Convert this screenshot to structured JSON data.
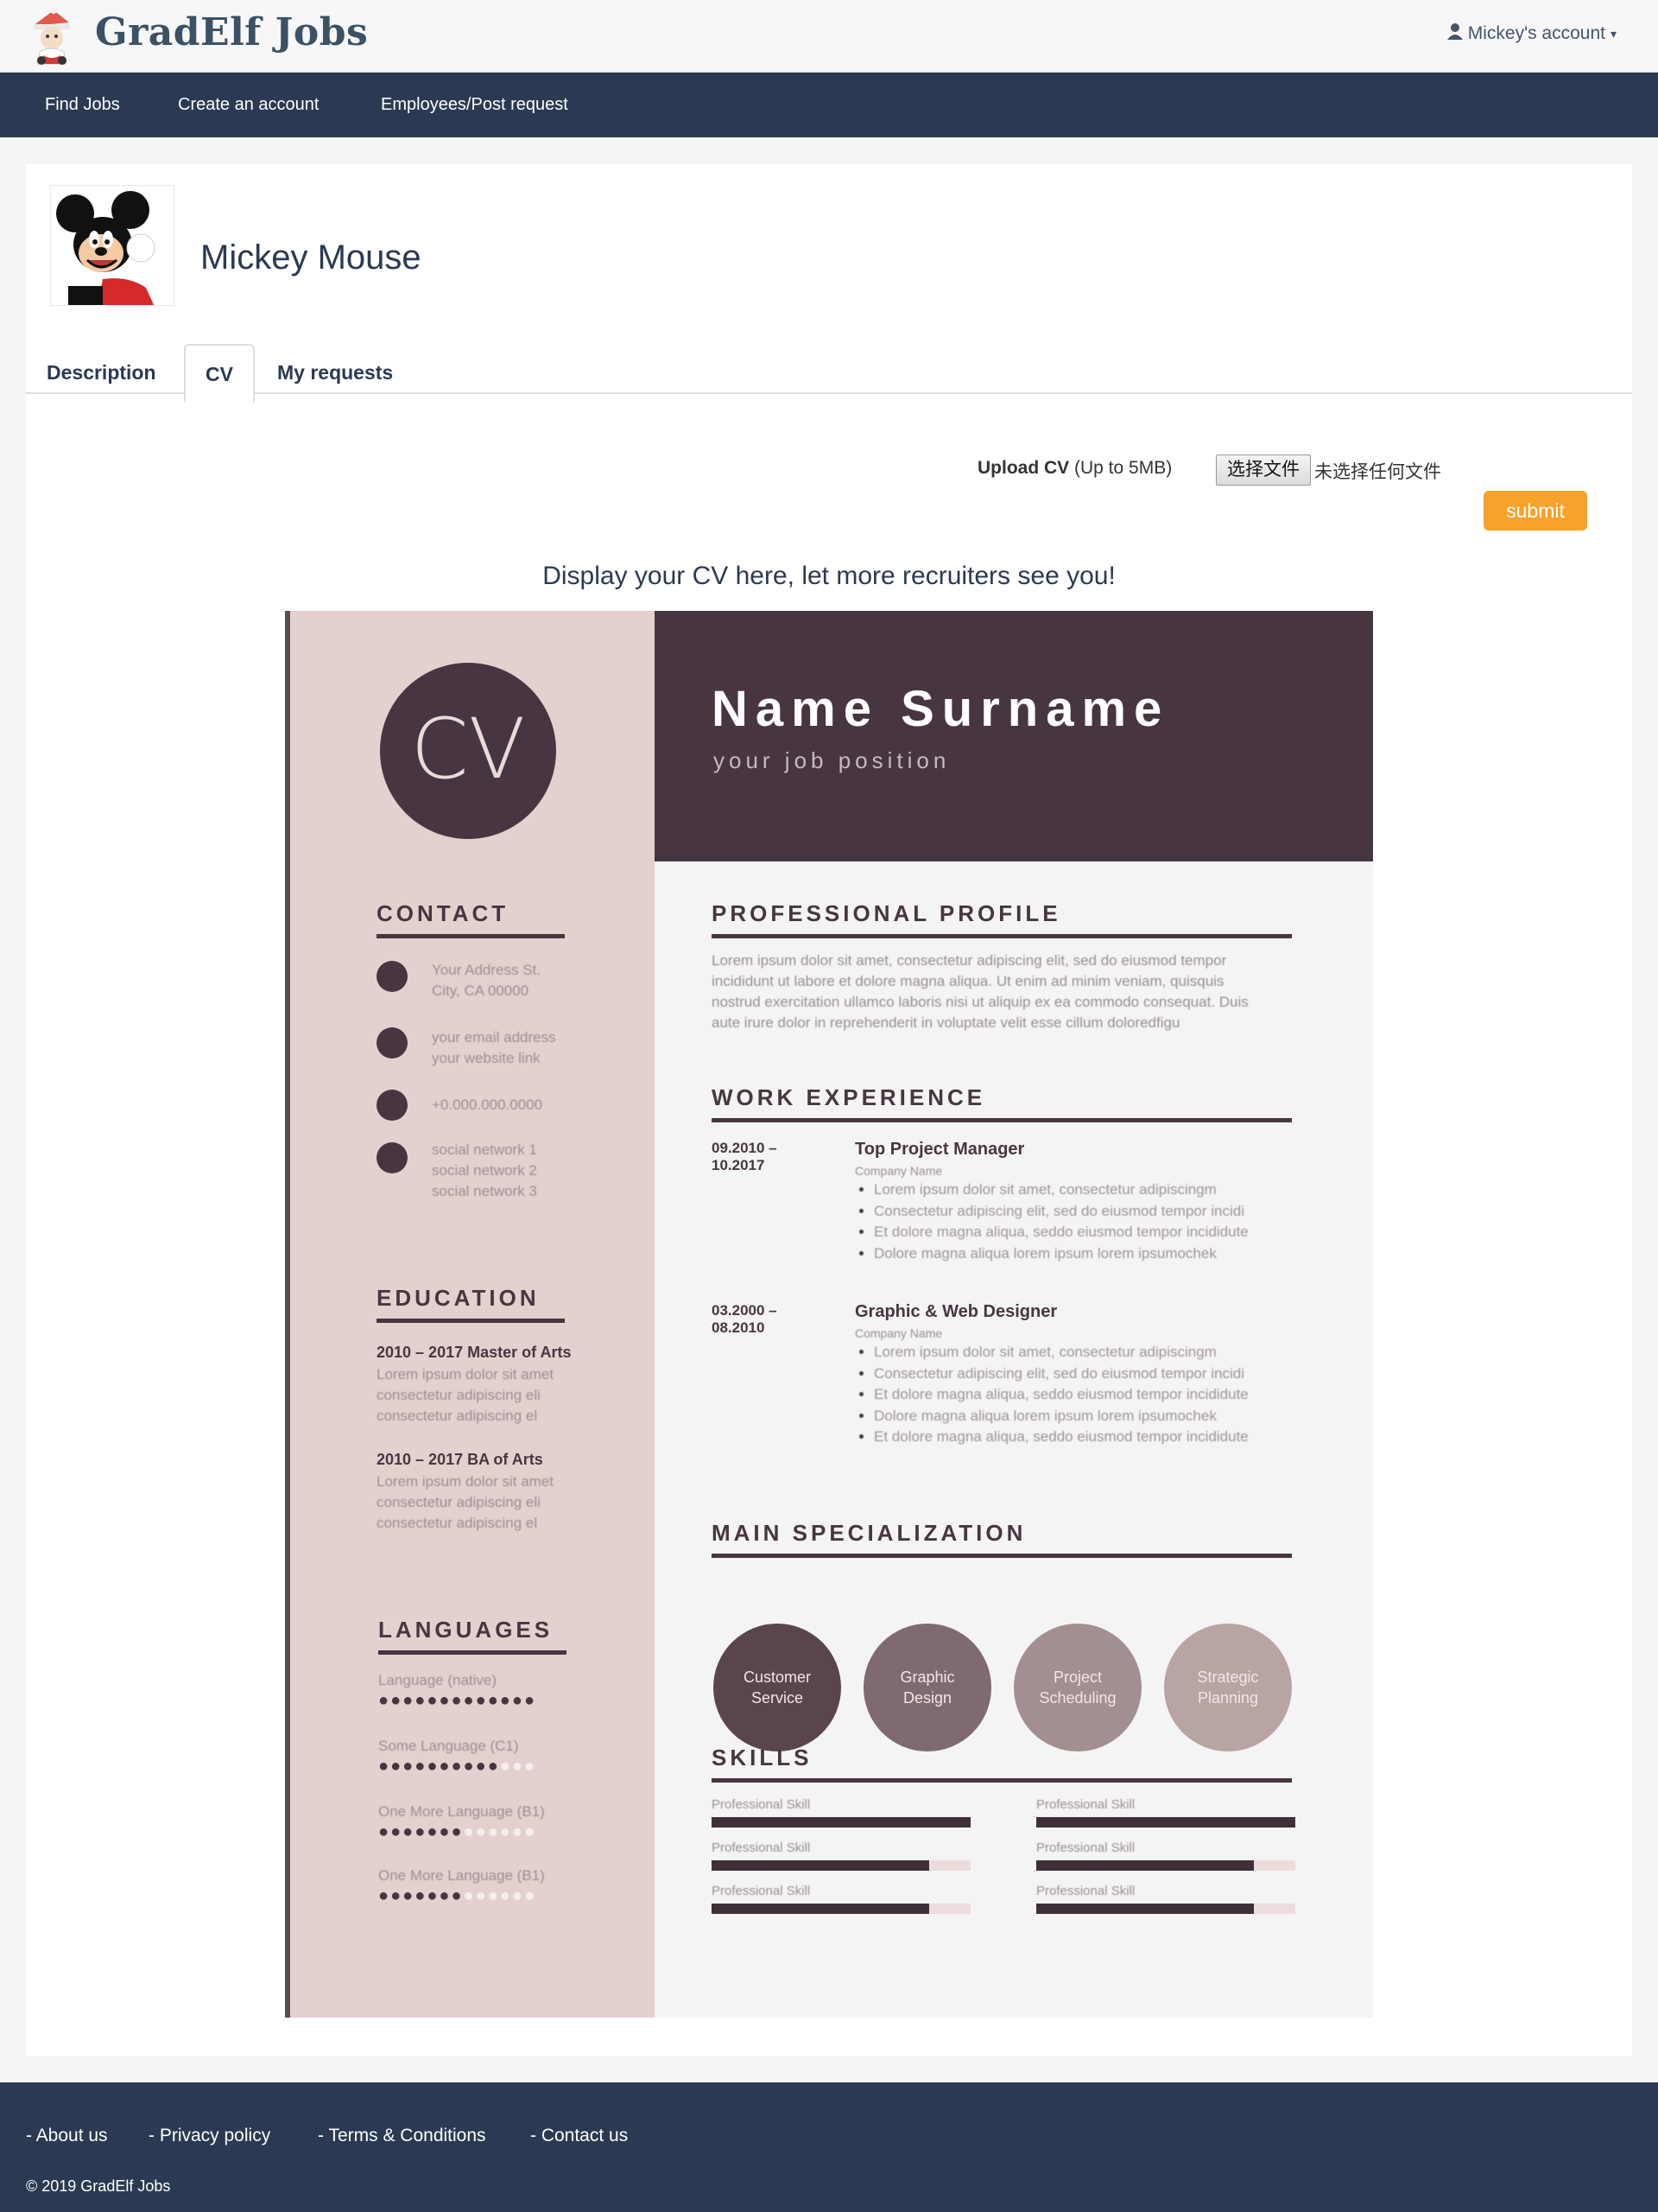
{
  "header": {
    "brand": "GradElf Jobs",
    "account_label": "Mickey's account"
  },
  "nav": {
    "items": [
      "Find Jobs",
      "Create an account",
      "Employees/Post request"
    ]
  },
  "profile": {
    "name": "Mickey Mouse"
  },
  "tabs": [
    {
      "label": "Description",
      "active": false
    },
    {
      "label": "CV",
      "active": true
    },
    {
      "label": "My requests",
      "active": false
    }
  ],
  "upload": {
    "label_bold": "Upload CV",
    "label_note": " (Up to 5MB)",
    "file_button": "选择文件",
    "file_status": "未选择任何文件",
    "submit": "submit"
  },
  "cv_caption": "Display your CV here, let more recruiters see you!",
  "cv": {
    "circle_text": "CV",
    "name": "Name Surname",
    "job": "your job position",
    "sections": {
      "contact": "CONTACT",
      "education": "EDUCATION",
      "languages": "LANGUAGES",
      "profile": "PROFESSIONAL PROFILE",
      "work": "WORK EXPERIENCE",
      "specialization": "MAIN SPECIALIZATION",
      "skills": "SKILLS"
    },
    "contact": {
      "address": "Your Address St.\nCity, CA 00000",
      "email": "your email address\nyour website link",
      "phone": "+0.000.000.0000",
      "social": "social network 1\nsocial network 2\nsocial network 3"
    },
    "education": [
      {
        "title": "2010 – 2017   Master of Arts",
        "desc": "Lorem ipsum dolor sit amet\nconsectetur adipiscing eli\nconsectetur adipiscing el"
      },
      {
        "title": "2010 – 2017   BA of Arts",
        "desc": "Lorem ipsum dolor sit amet\nconsectetur adipiscing eli\nconsectetur adipiscing el"
      }
    ],
    "languages": [
      {
        "name": "Language (native)",
        "level": 1.0
      },
      {
        "name": "Some Language (C1)",
        "level": 0.77
      },
      {
        "name": "One More Language (B1)",
        "level": 0.54
      },
      {
        "name": "One More Language (B1)",
        "level": 0.54
      }
    ],
    "profile_text": "Lorem ipsum dolor sit amet, consectetur adipiscing elit, sed do eiusmod tempor incididunt ut labore et dolore magna aliqua. Ut enim ad minim veniam, quisquis nostrud exercitation ullamco laboris nisi ut aliquip ex ea commodo consequat. Duis aute irure dolor in reprehenderit in voluptate velit esse cillum doloredfigu",
    "jobs": [
      {
        "dates": "09.2010 –\n10.2017",
        "title": "Top Project Manager",
        "company": "Company Name",
        "bullets": [
          "Lorem ipsum dolor sit amet, consectetur adipiscingm",
          "Consectetur adipiscing elit, sed do eiusmod tempor incidi",
          "Et dolore magna aliqua, seddo eiusmod tempor incididute",
          "Dolore magna aliqua lorem ipsum lorem ipsumochek"
        ]
      },
      {
        "dates": "03.2000 –\n08.2010",
        "title": "Graphic & Web Designer",
        "company": "Company Name",
        "bullets": [
          "Lorem ipsum dolor sit amet, consectetur adipiscingm",
          "Consectetur adipiscing elit, sed do eiusmod tempor incidi",
          "Et dolore magna aliqua, seddo eiusmod tempor incididute",
          "Dolore magna aliqua lorem ipsum lorem ipsumochek",
          "Et dolore magna aliqua, seddo eiusmod tempor incididute"
        ]
      }
    ],
    "specializations": [
      {
        "label": "Customer\nService",
        "color": "#5a454e"
      },
      {
        "label": "Graphic\nDesign",
        "color": "#7f6a70"
      },
      {
        "label": "Project\nScheduling",
        "color": "#a38f92"
      },
      {
        "label": "Strategic\nPlanning",
        "color": "#b9a4a4"
      }
    ],
    "skills": [
      {
        "label": "Professional Skill",
        "level": 1.0
      },
      {
        "label": "Professional Skill",
        "level": 1.0
      },
      {
        "label": "Professional Skill",
        "level": 0.84
      },
      {
        "label": "Professional Skill",
        "level": 0.84
      },
      {
        "label": "Professional Skill",
        "level": 0.84
      },
      {
        "label": "Professional Skill",
        "level": 0.84
      }
    ]
  },
  "footer": {
    "links": [
      "- About us",
      "- Privacy policy",
      "- Terms & Conditions",
      "- Contact us"
    ],
    "copyright": "© 2019 GradElf Jobs"
  },
  "colors": {
    "nav_bg": "#2b3a52",
    "accent": "#f7a22b",
    "cv_dark": "#473641",
    "cv_side": "#e4d1cf"
  }
}
